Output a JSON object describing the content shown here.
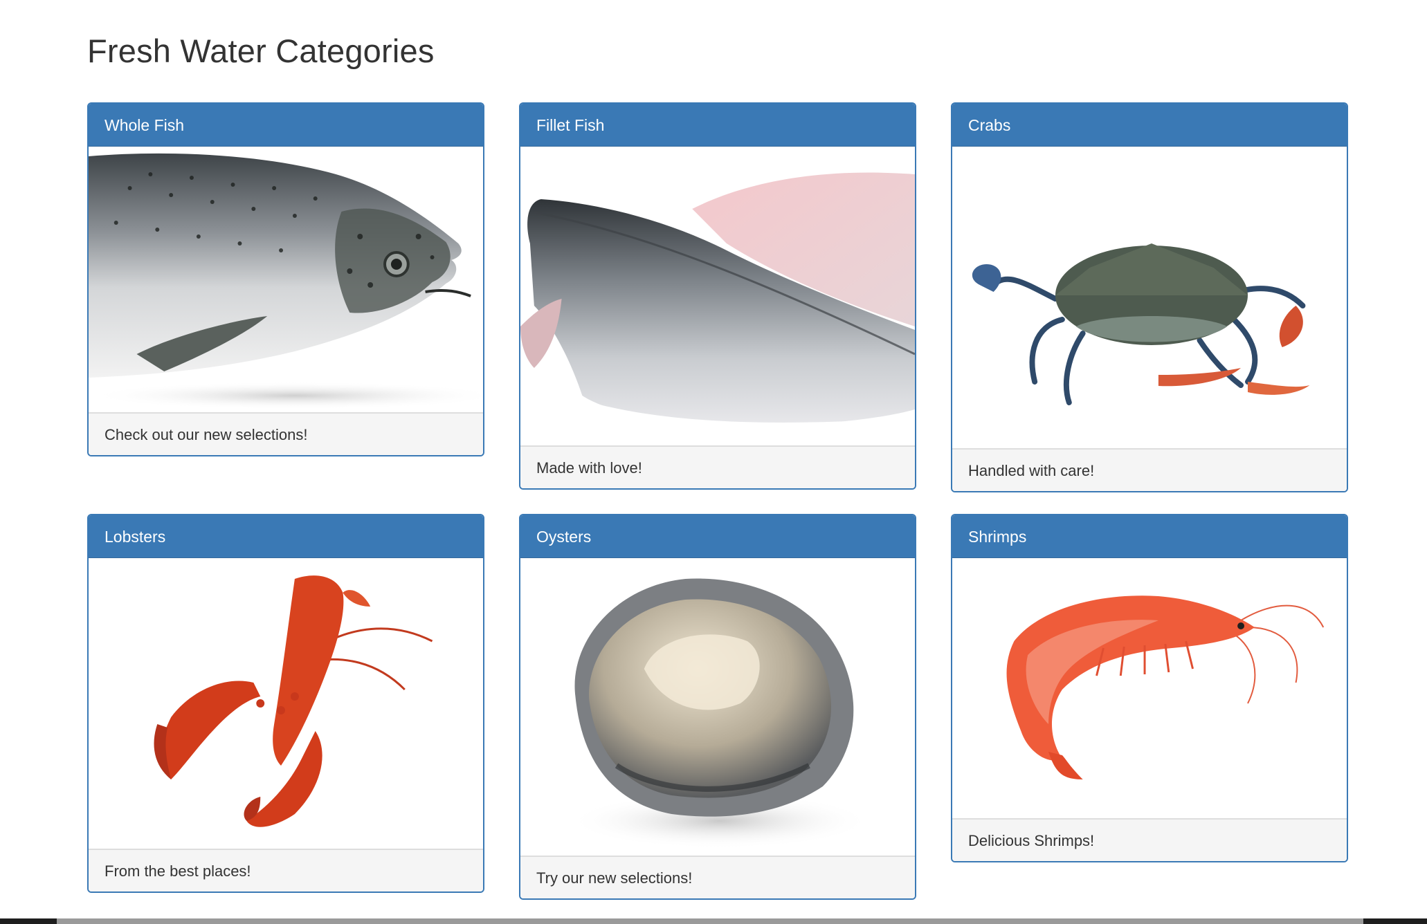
{
  "page": {
    "title": "Fresh Water Categories"
  },
  "categories": [
    {
      "title": "Whole Fish",
      "caption": "Check out our new selections!",
      "image": "whole-fish-image"
    },
    {
      "title": "Fillet Fish",
      "caption": "Made with love!",
      "image": "fillet-fish-image"
    },
    {
      "title": "Crabs",
      "caption": "Handled with care!",
      "image": "crab-image"
    },
    {
      "title": "Lobsters",
      "caption": "From the best places!",
      "image": "lobster-image"
    },
    {
      "title": "Oysters",
      "caption": "Try our new selections!",
      "image": "oyster-image"
    },
    {
      "title": "Shrimps",
      "caption": "Delicious Shrimps!",
      "image": "shrimp-image"
    }
  ],
  "colors": {
    "panel_primary": "#3a79b5",
    "footer_bg": "#f5f5f5",
    "title_text": "#333333"
  }
}
